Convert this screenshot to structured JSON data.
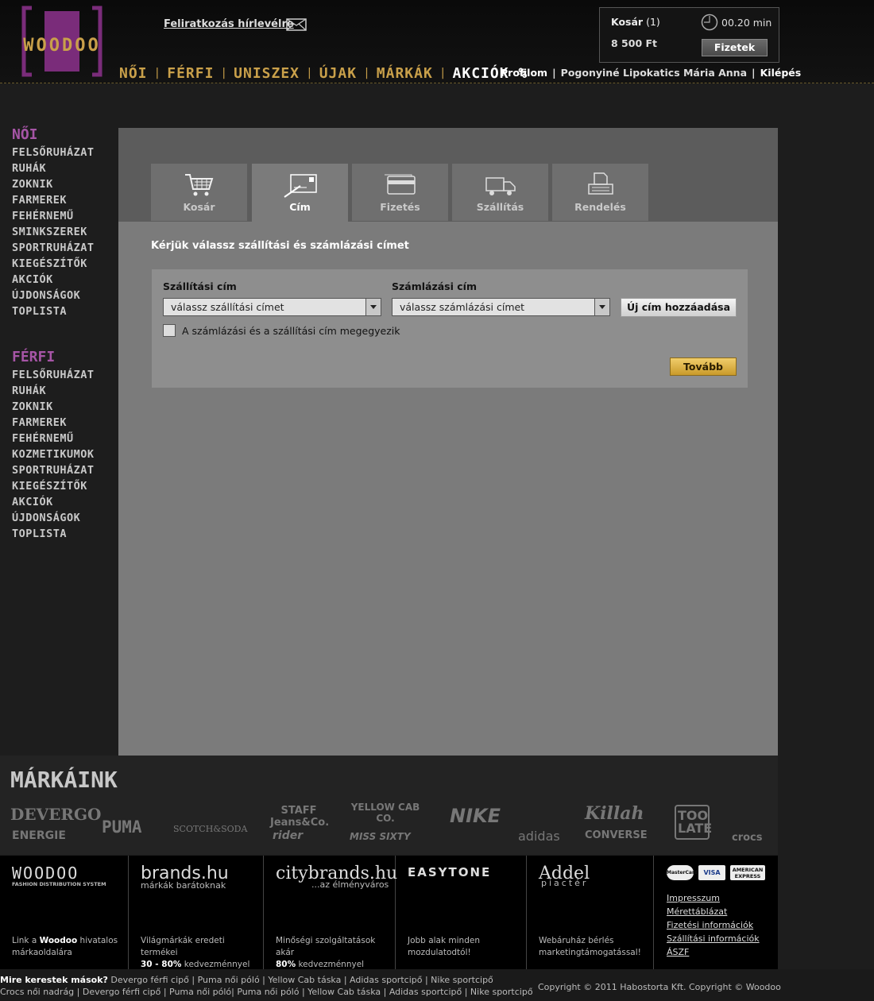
{
  "header": {
    "logo_text": "WOODOO",
    "newsletter": "Feliratkozás hírlevélre",
    "nav": [
      "NŐI",
      "FÉRFI",
      "UNISZEX",
      "ÚJAK",
      "MÁRKÁK",
      "AKCIÓK %"
    ],
    "user": {
      "profile": "Profilom",
      "name": "Pogonyiné Lipokatics Mária Anna",
      "logout": "Kilépés"
    },
    "cart": {
      "title": "Kosár",
      "count": "(1)",
      "total": "8 500 Ft",
      "timer": "00.20 min",
      "checkout": "Fizetek"
    }
  },
  "sidebar": {
    "women": {
      "heading": "NŐI",
      "items": [
        "FELSŐRUHÁZAT",
        "RUHÁK",
        "ZOKNIK",
        "FARMEREK",
        "FEHÉRNEMŰ",
        "SMINKSZEREK",
        "SPORTRUHÁZAT",
        "KIEGÉSZÍTŐK",
        "AKCIÓK",
        "ÚJDONSÁGOK",
        "TOPLISTA"
      ]
    },
    "men": {
      "heading": "FÉRFI",
      "items": [
        "FELSŐRUHÁZAT",
        "RUHÁK",
        "ZOKNIK",
        "FARMEREK",
        "FEHÉRNEMŰ",
        "KOZMETIKUMOK",
        "SPORTRUHÁZAT",
        "KIEGÉSZÍTŐK",
        "AKCIÓK",
        "ÚJDONSÁGOK",
        "TOPLISTA"
      ]
    }
  },
  "checkout": {
    "steps": [
      {
        "label": "Kosár",
        "icon": "cart-icon"
      },
      {
        "label": "Cím",
        "icon": "address-card-icon"
      },
      {
        "label": "Fizetés",
        "icon": "credit-card-icon"
      },
      {
        "label": "Szállítás",
        "icon": "truck-icon"
      },
      {
        "label": "Rendelés",
        "icon": "printer-icon"
      }
    ],
    "active_step": "Cím",
    "instruction": "Kérjük válassz szállítási és számlázási címet",
    "shipping_label": "Szállítási cím",
    "shipping_value": "válassz szállítási címet",
    "billing_label": "Számlázási cím",
    "billing_value": "válassz számlázási címet",
    "new_address": "Új cím hozzáadása",
    "same_address": "A számlázási és a szállítási cím megegyezik",
    "next": "Tovább"
  },
  "brands": {
    "title": "MÁRKÁINK",
    "items": [
      "DEVERGO",
      "ENERGIE",
      "PUMA",
      "SCOTCH&SODA",
      "STAFF Jeans&Co.",
      "rider",
      "YELLOW CAB CO.",
      "MISS SIXTY",
      "NIKE",
      "adidas",
      "Killah",
      "CONVERSE",
      "TOO LATE",
      "crocs"
    ]
  },
  "footer": {
    "woodoo": {
      "title": "WOODOO",
      "sub": "FASHION DISTRIBUTION SYSTEM",
      "text_pre": "Link a ",
      "text_bold": "Woodoo",
      "text_post": " hivatalos márkaoldalára"
    },
    "brandshu": {
      "title": "brands.hu",
      "sub": "márkák barátoknak",
      "text": "Világmárkák eredeti termékei",
      "text_bold": "30 - 80%",
      "text_post": " kedvezménnyel"
    },
    "citybrands": {
      "title": "citybrands.hu",
      "sub": "...az élményváros",
      "text": "Minőségi szolgáltatások akár",
      "text_bold": "80%",
      "text_post": " kedvezménnyel"
    },
    "easytone": {
      "title": "EASYTONE",
      "text": "Jobb alak minden mozdulatodtól!"
    },
    "addel": {
      "title": "Addel",
      "sub": "piactér",
      "text": "Webáruház bérlés marketingtámogatással!"
    },
    "cards": [
      "MasterCard",
      "VISA",
      "AMERICAN EXPRESS"
    ],
    "links": [
      "Impresszum",
      "Mérettáblázat",
      "Fizetési információk",
      "Szállítási információk",
      "ÁSZF"
    ]
  },
  "bottom": {
    "others_label": "Mire kerestek mások?",
    "others_line1": "Devergo férfi cipő | Puma női póló | Yellow Cab táska | Adidas sportcipő | Nike sportcipő",
    "others_line2": "Crocs női nadrág | Devergo férfi cipő | Puma női póló| Puma női póló | Yellow Cab táska | Adidas sportcipő | Nike sportcipő",
    "copyright": "Copyright © 2011 Habostorta Kft.   Copyright © Woodoo"
  },
  "colors": {
    "accent_gold": "#c9a04a",
    "accent_purple": "#a655a6",
    "panel": "#7b7b7b"
  }
}
